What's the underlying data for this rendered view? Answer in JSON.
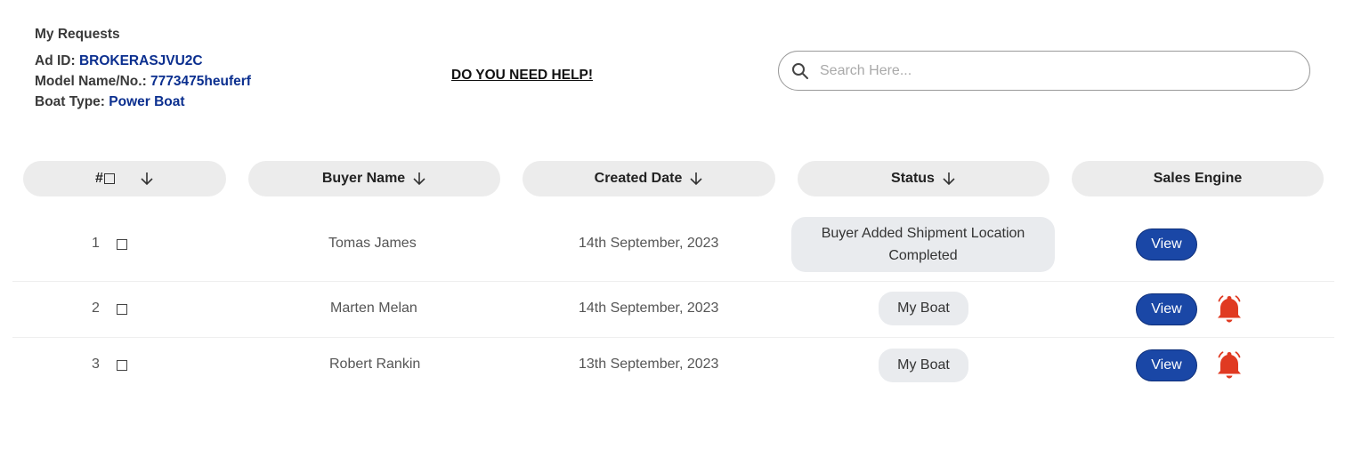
{
  "info": {
    "title": "My Requests",
    "ad_id_label": "Ad ID:",
    "ad_id_value": "BROKERASJVU2C",
    "model_label": "Model Name/No.:",
    "model_value": "7773475heuferf",
    "boat_type_label": "Boat Type:",
    "boat_type_value": "Power Boat"
  },
  "help_link": "DO YOU NEED HELP!",
  "search": {
    "placeholder": "Search Here...",
    "value": ""
  },
  "table": {
    "headers": [
      "#",
      "Buyer Name",
      "Created Date",
      "Status",
      "Sales Engine"
    ],
    "rows": [
      {
        "num": "1",
        "buyer": "Tomas James",
        "date": "14th September, 2023",
        "status_line1": "Buyer Added Shipment Location",
        "status_line2": "Completed",
        "action": "View",
        "has_alert": false
      },
      {
        "num": "2",
        "buyer": "Marten Melan",
        "date": "14th September, 2023",
        "status": "My Boat",
        "action": "View",
        "has_alert": true
      },
      {
        "num": "3",
        "buyer": "Robert Rankin",
        "date": "13th September, 2023",
        "status": "My Boat",
        "action": "View",
        "has_alert": true
      }
    ]
  },
  "colors": {
    "accent_blue": "#1a47a6",
    "value_blue": "#0b2f8f",
    "alert_red": "#e03a22",
    "header_bg": "#ececec",
    "badge_bg": "#e9ebee"
  },
  "icons": {
    "search": "search-icon",
    "sort": "arrow-down-icon",
    "alert": "bell-icon"
  }
}
